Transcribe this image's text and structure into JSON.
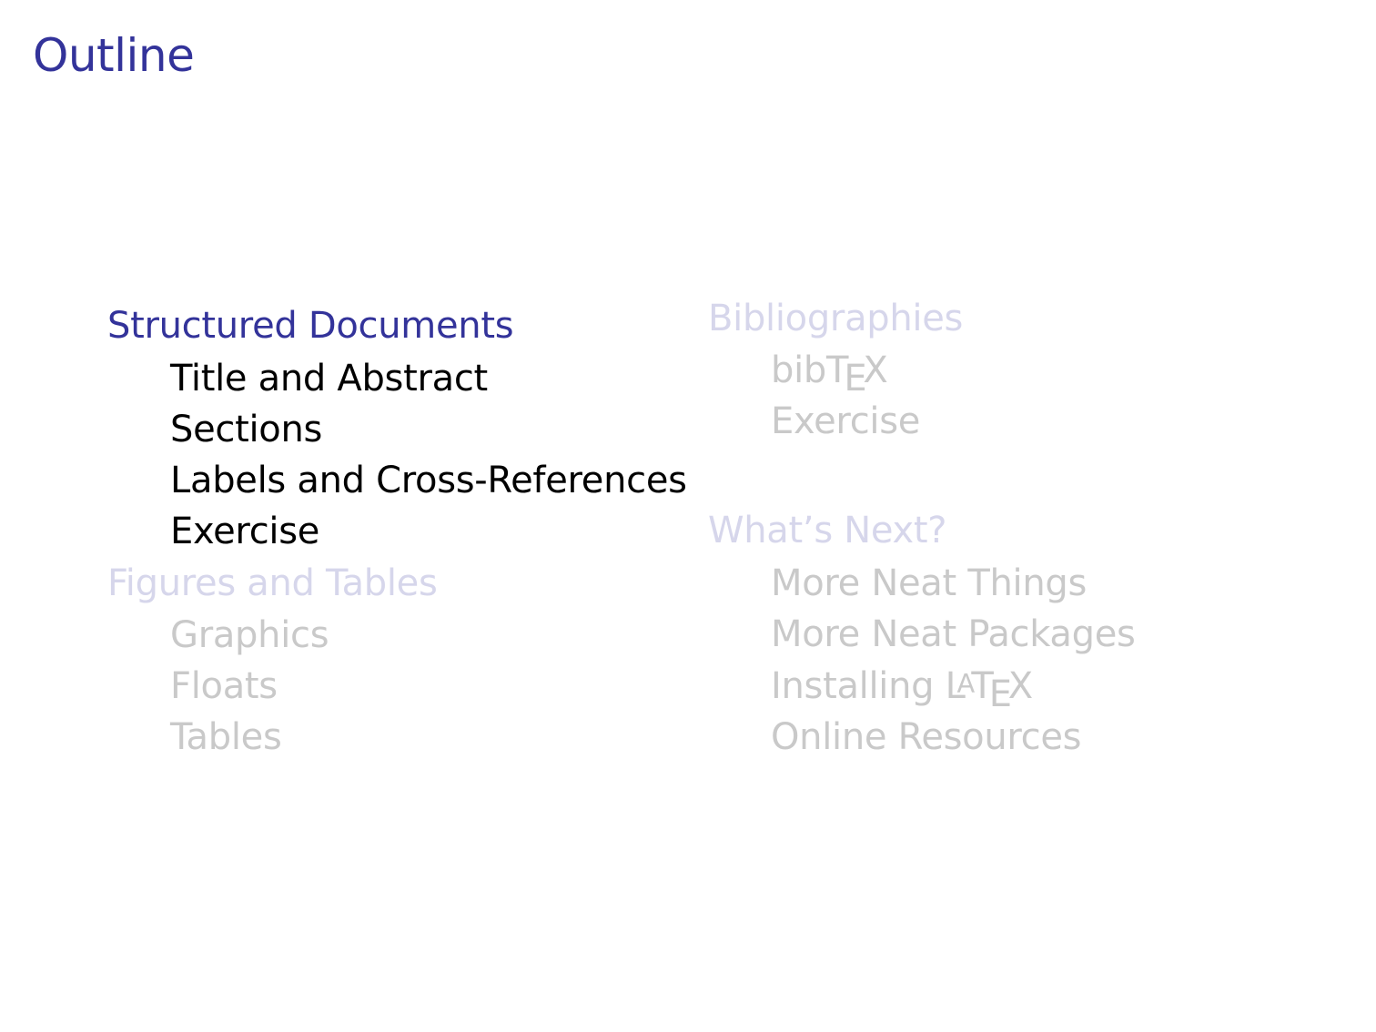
{
  "frame": {
    "title": "Outline"
  },
  "outline": {
    "left": [
      {
        "section": "Structured Documents",
        "state": "active",
        "items": [
          "Title and Abstract",
          "Sections",
          "Labels and Cross-References",
          "Exercise"
        ]
      },
      {
        "section": "Figures and Tables",
        "state": "inactive",
        "items": [
          "Graphics",
          "Floats",
          "Tables"
        ]
      }
    ],
    "right": [
      {
        "section": "Bibliographies",
        "state": "inactive",
        "items": [
          "bibTEX",
          "Exercise"
        ]
      },
      {
        "section": "What’s Next?",
        "state": "inactive",
        "items": [
          "More Neat Things",
          "More Neat Packages",
          "Installing LATEX",
          "Online Resources"
        ]
      }
    ]
  },
  "colors": {
    "structure_blue": "#33339a",
    "inactive_section": "#d6d6eb",
    "active_item": "#000000",
    "inactive_item": "#c9c9c9"
  }
}
